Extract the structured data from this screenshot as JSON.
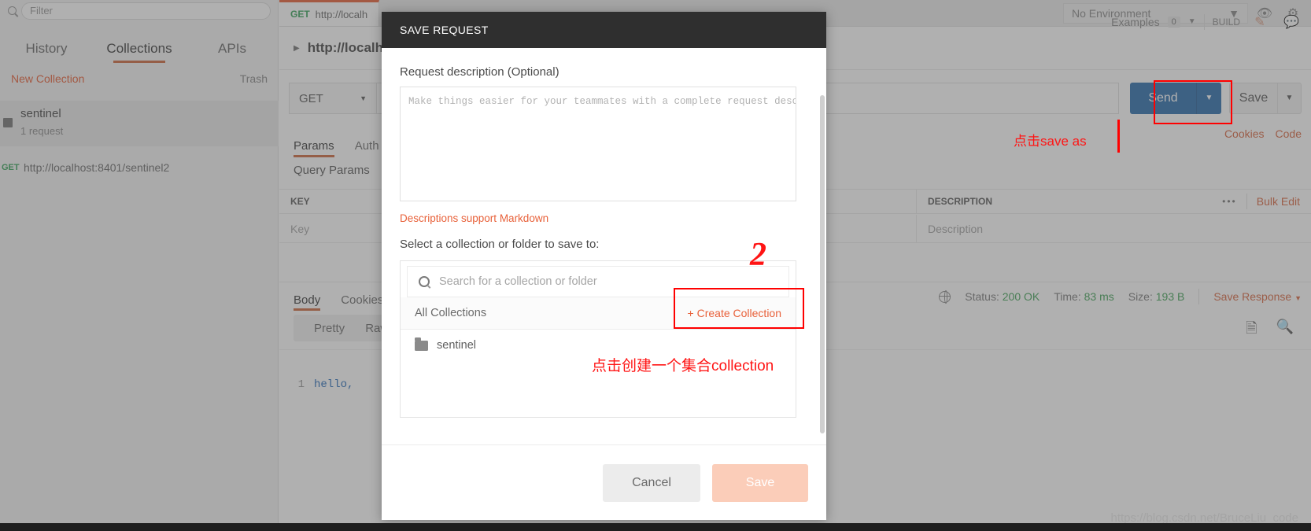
{
  "sidebar": {
    "filter_placeholder": "Filter",
    "search_icon": "search-icon",
    "tabs": [
      {
        "label": "History",
        "active": false
      },
      {
        "label": "Collections",
        "active": true
      },
      {
        "label": "APIs",
        "active": false
      }
    ],
    "new_collection_label": "New Collection",
    "trash_label": "Trash",
    "collection": {
      "name": "sentinel",
      "meta": "1 request"
    },
    "request": {
      "method": "GET",
      "url": "http://localhost:8401/sentinel2"
    }
  },
  "tabbar": {
    "open_tab": {
      "method": "GET",
      "url": "http://localh"
    },
    "environment": "No Environment",
    "eye_icon": "eye-icon",
    "gear_icon": "gear-icon"
  },
  "request_header": {
    "title": "http://localh",
    "examples_label": "Examples",
    "examples_count": "0",
    "build_label": "BUILD",
    "edit_icon": "pencil-icon",
    "comment_icon": "comment-icon"
  },
  "url_row": {
    "method": "GET",
    "url_value": "",
    "send_label": "Send",
    "save_label": "Save"
  },
  "sub_links": {
    "cookies": "Cookies",
    "code": "Code"
  },
  "param_tabs": [
    {
      "label": "Params",
      "active": true
    },
    {
      "label": "Auth",
      "active": false
    }
  ],
  "query_params_label": "Query Params",
  "params_table": {
    "headers": {
      "key": "KEY",
      "value": "",
      "description": "DESCRIPTION"
    },
    "dots_label": "•••",
    "bulk_edit_label": "Bulk Edit",
    "rows": [
      {
        "key": "Key",
        "value": "",
        "description": "Description"
      }
    ]
  },
  "response": {
    "tabs": [
      {
        "label": "Body",
        "active": true
      },
      {
        "label": "Cookies",
        "active": false
      }
    ],
    "globe_icon": "globe-icon",
    "status_label": "Status:",
    "status_value": "200 OK",
    "time_label": "Time:",
    "time_value": "83 ms",
    "size_label": "Size:",
    "size_value": "193 B",
    "save_response_label": "Save Response",
    "view_tabs": [
      {
        "label": "Pretty"
      },
      {
        "label": "Raw"
      }
    ],
    "body_line_number": "1",
    "body_text": "hello,",
    "copy_icon": "copy-icon",
    "search_icon": "search-icon"
  },
  "modal": {
    "title": "SAVE REQUEST",
    "description_label": "Request description (Optional)",
    "description_value": "",
    "description_placeholder": "Make things easier for your teammates with a complete request description.",
    "markdown_note_prefix": "Descriptions support ",
    "markdown_link": "Markdown",
    "select_label": "Select a collection or folder to save to:",
    "search_placeholder": "Search for a collection or folder",
    "search_icon": "search-icon",
    "all_collections_label": "All Collections",
    "create_collection_label": "+ Create Collection",
    "items": [
      {
        "name": "sentinel",
        "icon": "folder-icon"
      }
    ],
    "cancel_label": "Cancel",
    "save_label": "Save"
  },
  "annotations": {
    "step_two_mark": "2",
    "save_as_text": "点击save as",
    "create_collection_text": "点击创建一个集合collection"
  },
  "watermark": "https://blog.csdn.net/BruceLiu_code",
  "colors": {
    "accent_orange": "#e8613a",
    "send_blue": "#2f6fae",
    "status_green": "#45a45b",
    "annotation_red": "#ff0000",
    "modal_header": "#2f2f2f"
  }
}
